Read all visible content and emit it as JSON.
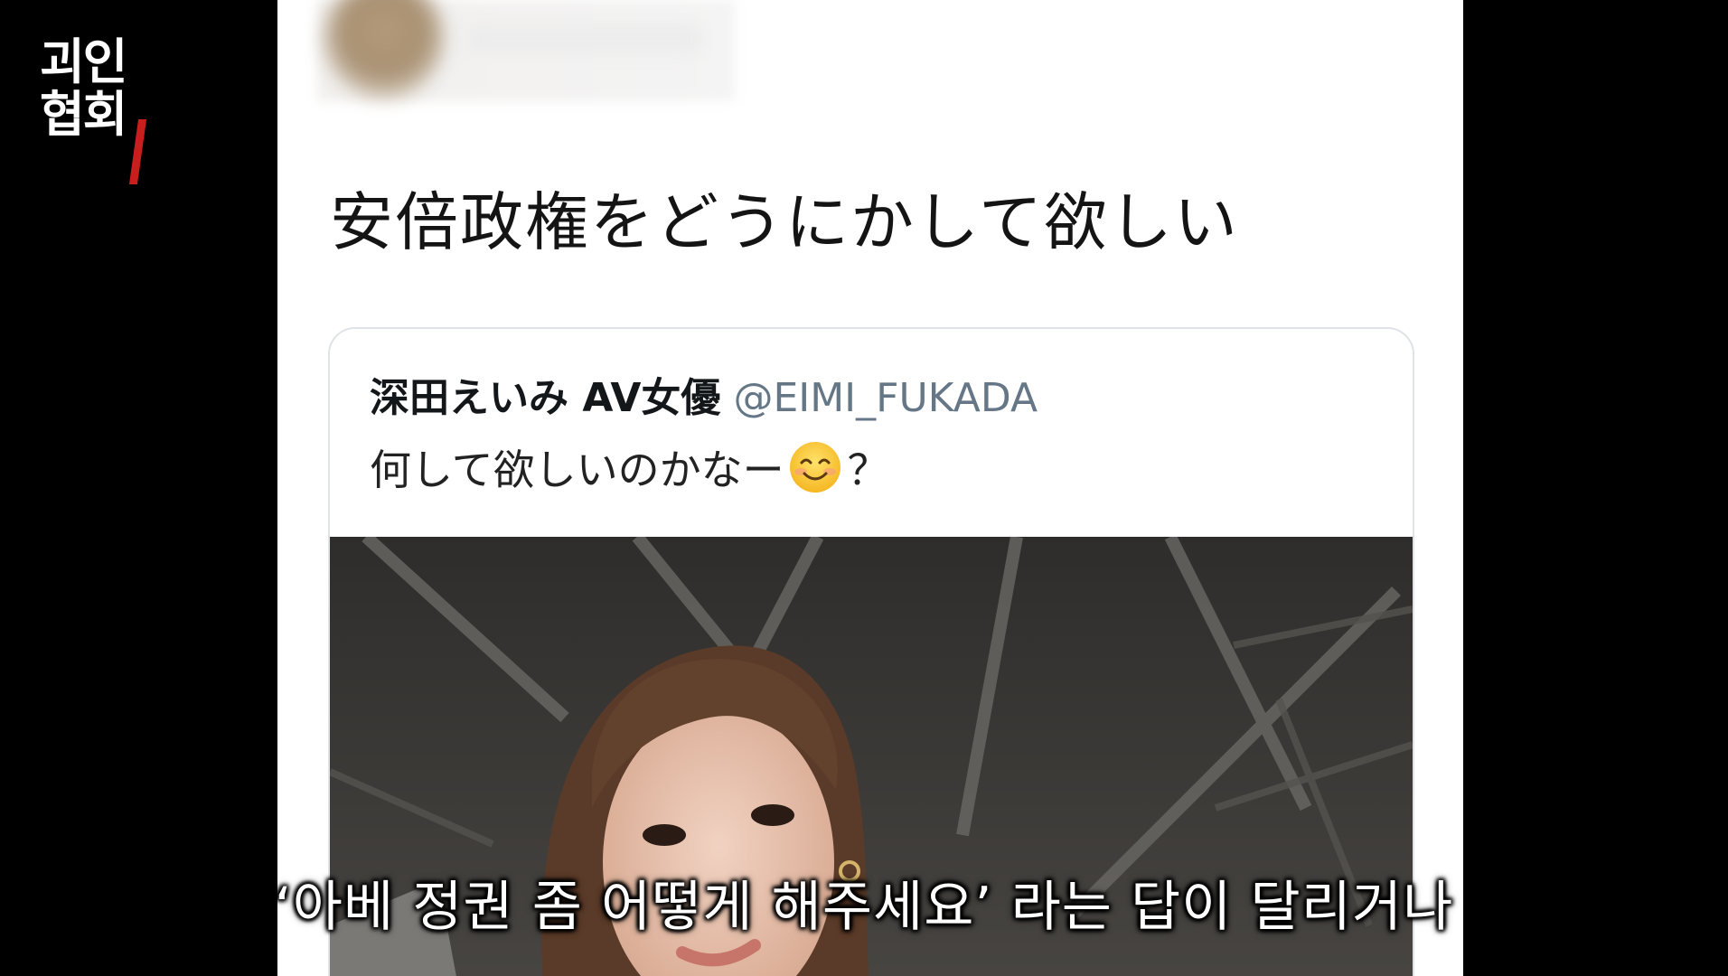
{
  "channel": {
    "logo_line1": "괴인",
    "logo_line2": "협회"
  },
  "tweet": {
    "text": "安倍政権をどうにかして欲しい"
  },
  "quoted_tweet": {
    "name": "深田えいみ AV女優",
    "handle": "@EIMI_FUKADA",
    "text_before_emoji": "何して欲しいのかなー",
    "emoji": "smiling-face-emoji",
    "text_after_emoji": "？"
  },
  "subtitle": {
    "text": "‘아베 정권 좀 어떻게 해주세요’ 라는 답이 달리거나"
  },
  "colors": {
    "background": "#000000",
    "panel": "#ffffff",
    "handle": "#657786",
    "logo_accent": "#c81e1e"
  }
}
